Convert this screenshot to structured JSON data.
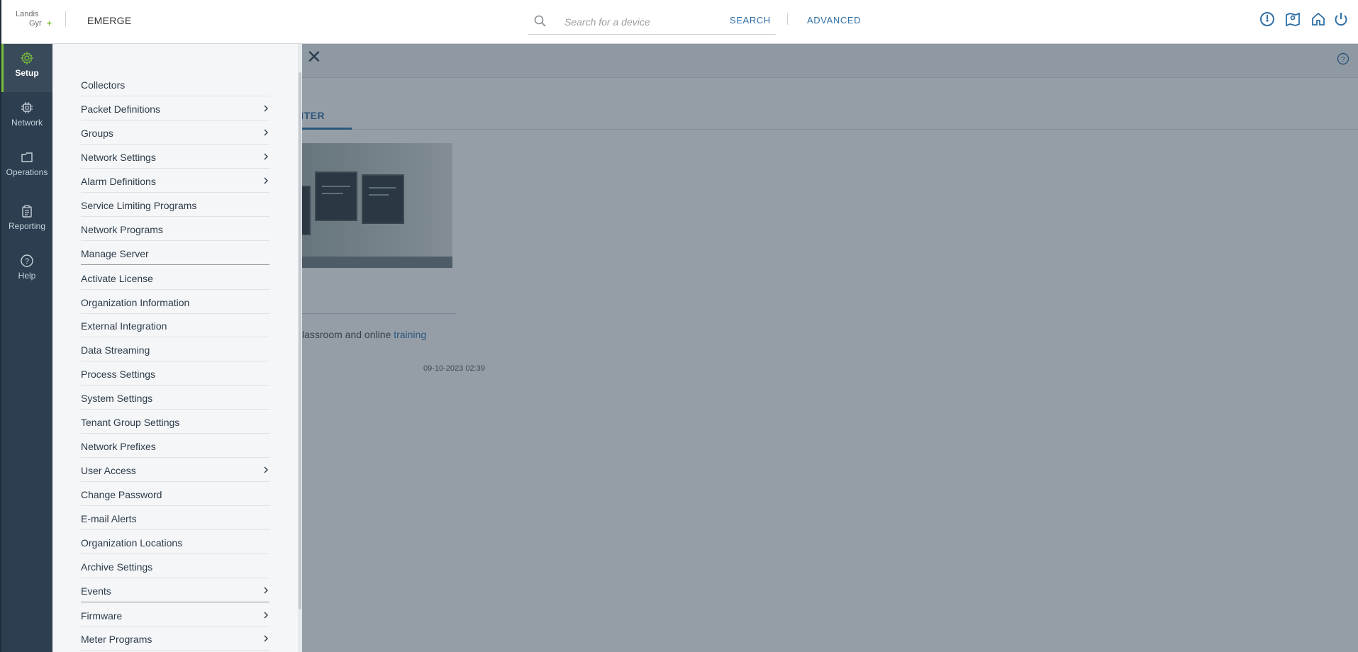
{
  "header": {
    "logo_line1": "Landis",
    "logo_line2": "Gyr",
    "logo_plus": "+",
    "app_name": "EMERGE",
    "search_placeholder": "Search for a device",
    "search_button": "SEARCH",
    "advanced_button": "ADVANCED",
    "icons": [
      "gauge-icon",
      "map-pin-icon",
      "home-icon",
      "power-icon"
    ]
  },
  "rail": {
    "items": [
      {
        "label": "Setup",
        "icon": "gear-icon",
        "active": true
      },
      {
        "label": "Network",
        "icon": "chip-icon",
        "active": false
      },
      {
        "label": "Operations",
        "icon": "folder-icon",
        "active": false
      },
      {
        "label": "Reporting",
        "icon": "clipboard-icon",
        "active": false
      },
      {
        "label": "Help",
        "icon": "question-icon",
        "active": false
      }
    ]
  },
  "page": {
    "tab_partial": "NTER",
    "training_text": "classroom and online ",
    "training_link": "training",
    "timestamp": "09-10-2023 02:39"
  },
  "menu": {
    "items": [
      {
        "label": "Collectors",
        "has_children": false
      },
      {
        "label": "Packet Definitions",
        "has_children": true
      },
      {
        "label": "Groups",
        "has_children": true
      },
      {
        "label": "Network Settings",
        "has_children": true
      },
      {
        "label": "Alarm Definitions",
        "has_children": true
      },
      {
        "label": "Service Limiting Programs",
        "has_children": false
      },
      {
        "label": "Network Programs",
        "has_children": false
      },
      {
        "label": "Manage Server",
        "has_children": false
      },
      {
        "label": "Activate License",
        "has_children": false
      },
      {
        "label": "Organization Information",
        "has_children": false
      },
      {
        "label": "External Integration",
        "has_children": false
      },
      {
        "label": "Data Streaming",
        "has_children": false
      },
      {
        "label": "Process Settings",
        "has_children": false
      },
      {
        "label": "System Settings",
        "has_children": false
      },
      {
        "label": "Tenant Group Settings",
        "has_children": false
      },
      {
        "label": "Network Prefixes",
        "has_children": false
      },
      {
        "label": "User Access",
        "has_children": true
      },
      {
        "label": "Change Password",
        "has_children": false
      },
      {
        "label": "E-mail Alerts",
        "has_children": false
      },
      {
        "label": "Organization Locations",
        "has_children": false
      },
      {
        "label": "Archive Settings",
        "has_children": false
      },
      {
        "label": "Events",
        "has_children": true
      },
      {
        "label": "Firmware",
        "has_children": true
      },
      {
        "label": "Meter Programs",
        "has_children": true
      }
    ]
  },
  "colors": {
    "rail_bg": "#2c3e50",
    "accent_green": "#7bbf3a",
    "link_blue": "#2f6fa6",
    "menu_bg": "#f4f6f8"
  }
}
